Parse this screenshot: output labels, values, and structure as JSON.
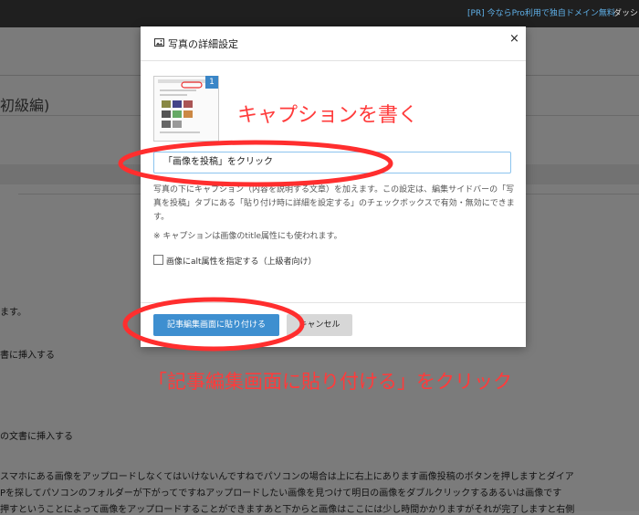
{
  "topbar": {
    "pr_link": "[PR] 今ならPro利用で独自ドメイン無料",
    "dashboard": "ダッシ"
  },
  "background": {
    "title": "初級編)",
    "lines": [
      "ます。",
      "書に挿入する",
      "の文書に挿入する",
      "スマホにある画像をアップロードしなくてはいけないんですねでパソコンの場合は上に右上にあります画像投稿のボタンを押しますとダイア",
      "Pを探してパソコンのフォルダーが下がってですねアップロードしたい画像を見つけて明日の画像をダブルクリックするあるいは画像です",
      "押すということによって画像をアップロードすることができますあと下からと画像はここには少し時間かかりますがそれが完了しますと右側"
    ]
  },
  "modal": {
    "title": "写真の詳細設定",
    "close": "×",
    "badge": "1",
    "caption_value": "「画像を投稿」をクリック",
    "description": "写真の下にキャプション（内容を説明する文章）を加えます。この設定は、編集サイドバーの「写真を投稿」タブにある「貼り付け時に詳細を設定する」のチェックボックスで有効・無効にできます。",
    "note": "※ キャプションは画像のtitle属性にも使われます。",
    "alt_checkbox_label": "画像にalt属性を指定する（上級者向け）",
    "primary_button": "記事編集画面に貼り付ける",
    "cancel_button": "キャンセル"
  },
  "annotations": {
    "caption_hint": "キャプションを書く",
    "paste_hint": "「記事編集画面に貼り付ける」をクリック",
    "color": "#ff3b3b"
  }
}
